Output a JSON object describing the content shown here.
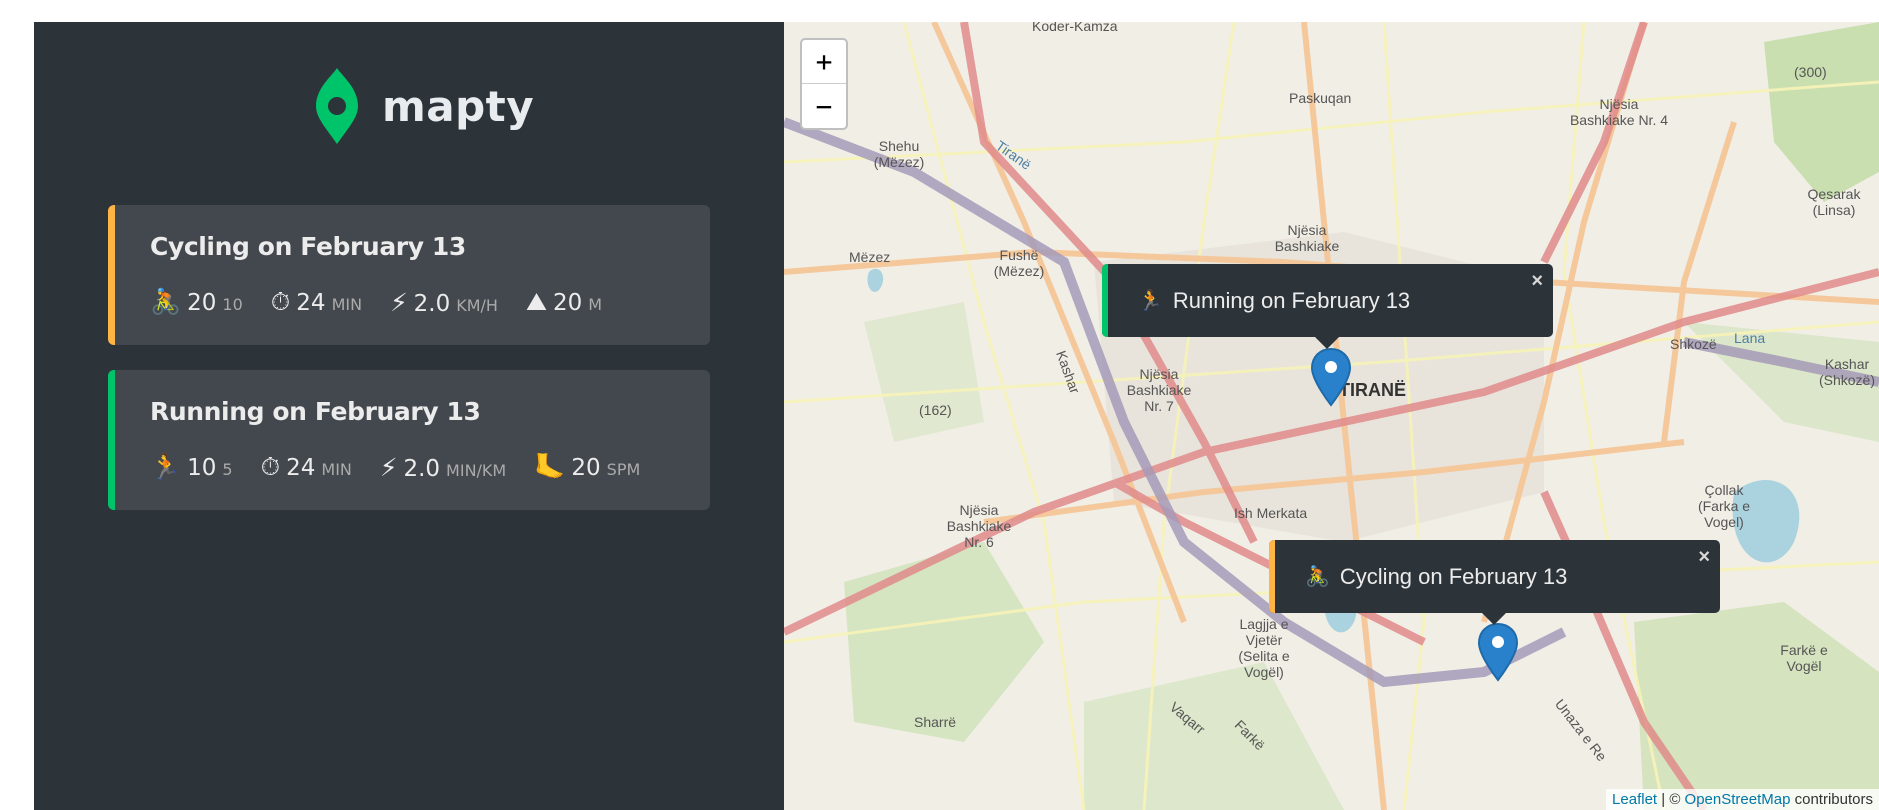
{
  "brand": {
    "name": "mapty",
    "accent": "#00c46a"
  },
  "workouts": [
    {
      "type": "cycling",
      "title": "Cycling on February 13",
      "color": "#ffb545",
      "details": [
        {
          "icon": "cycling-icon",
          "glyph": "🚴",
          "value": "20",
          "unit": "10"
        },
        {
          "icon": "stopwatch-icon",
          "glyph": "⏱",
          "value": "24",
          "unit": "min"
        },
        {
          "icon": "lightning-icon",
          "glyph": "⚡",
          "value": "2.0",
          "unit": "km/h"
        },
        {
          "icon": "mountain-icon",
          "glyph": "⛰",
          "value": "20",
          "unit": "m"
        }
      ]
    },
    {
      "type": "running",
      "title": "Running on February 13",
      "color": "#00c46a",
      "details": [
        {
          "icon": "running-icon",
          "glyph": "🏃",
          "value": "10",
          "unit": "5"
        },
        {
          "icon": "stopwatch-icon",
          "glyph": "⏱",
          "value": "24",
          "unit": "min"
        },
        {
          "icon": "lightning-icon",
          "glyph": "⚡",
          "value": "2.0",
          "unit": "min/km"
        },
        {
          "icon": "foot-icon",
          "glyph": "🦶",
          "value": "20",
          "unit": "spm"
        }
      ]
    }
  ],
  "map": {
    "zoom_in": "+",
    "zoom_out": "−",
    "popups": [
      {
        "glyph": "🏃",
        "text": "Running on February 13",
        "close": "×"
      },
      {
        "glyph": "🚴",
        "text": "Cycling on February 13",
        "close": "×"
      }
    ],
    "attribution": {
      "leaflet": "Leaflet",
      "sep": " | © ",
      "osm": "OpenStreetMap",
      "suffix": " contributors"
    },
    "place_labels": [
      "Koder-Kamza",
      "Paskuqan",
      "Njësia Bashkiake Nr. 4",
      "(300)",
      "Shehu (Mëzez)",
      "Mëzez",
      "Fushë (Mëzez)",
      "Njësia Bashkiake",
      "Qesarak (Linsa)",
      "Njësia Bashkiake Nr. 7",
      "TIRANË",
      "(162)",
      "Shkozë",
      "Kashar (Shkozë)",
      "Lana",
      "Njësia Bashkiake Nr. 6",
      "Ish Merkata",
      "Çollak (Farka e Vogel)",
      "Lagjja e Vjetër (Selita e Vogël)",
      "Sharrë",
      "Farkë e Vogël",
      "Unaza e Re",
      "Kashar",
      "Tiranë",
      "Vaqarr",
      "Farkë"
    ]
  }
}
